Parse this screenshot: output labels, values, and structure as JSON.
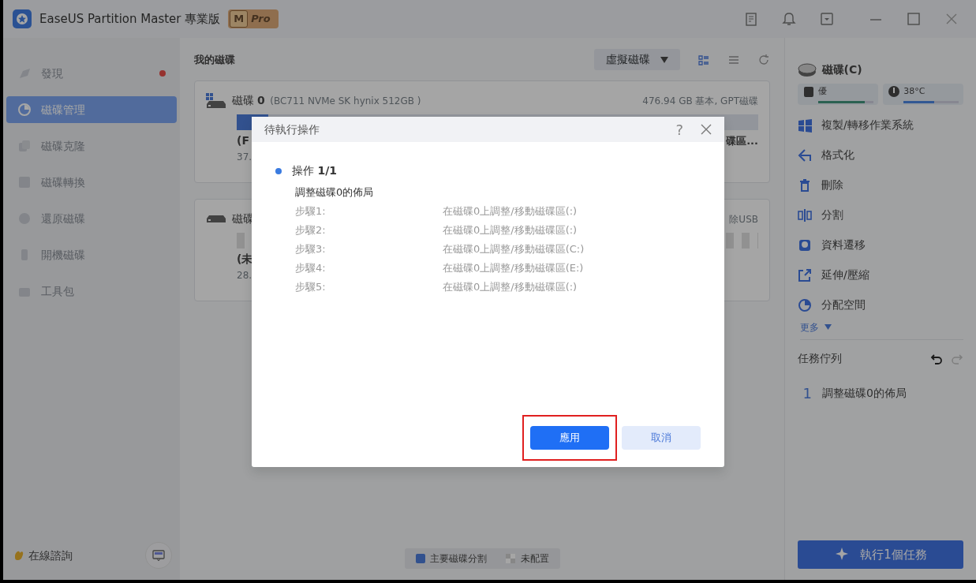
{
  "window": {
    "title": "EaseUS Partition Master 專業版",
    "badge_letter": "M",
    "badge": "Pro"
  },
  "sidebar": {
    "items": [
      {
        "label": "發現",
        "selected": false,
        "notification": true
      },
      {
        "label": "磁碟管理",
        "selected": true,
        "notification": false
      },
      {
        "label": "磁碟克隆",
        "selected": false,
        "notification": false
      },
      {
        "label": "磁碟轉換",
        "selected": false,
        "notification": false
      },
      {
        "label": "還原磁碟",
        "selected": false,
        "notification": false
      },
      {
        "label": "開機磁碟",
        "selected": false,
        "notification": false
      },
      {
        "label": "工具包",
        "selected": false,
        "notification": false
      }
    ],
    "chat": "在線諮詢"
  },
  "main": {
    "title": "我的磁碟",
    "view_dropdown": "虛擬磁碟",
    "disks": [
      {
        "name": "磁碟 **0**",
        "model": "(BC711 NVMe SK hynix 512GB )",
        "info": "476.94 GB 基本, GPT磁碟",
        "partition_label": "(F",
        "partition_size": "37.",
        "partition_right": "碟區...",
        "kind": "system"
      },
      {
        "name": "磁碟",
        "info": "除USB",
        "partition_label": "(未",
        "partition_size": "28.",
        "kind": "usb"
      }
    ],
    "legend": [
      {
        "label": "主要磁碟分割",
        "kind": "primary"
      },
      {
        "label": "未配置",
        "kind": "unallocated"
      }
    ]
  },
  "right_panel": {
    "drive": "磁碟(C)",
    "health": {
      "label": "優",
      "level": 0.85
    },
    "temperature": {
      "label": "38°C",
      "level": 0.55
    },
    "actions": [
      "複製/轉移作業系統",
      "格式化",
      "刪除",
      "分割",
      "資料遷移",
      "延伸/壓縮",
      "分配空間"
    ],
    "more": "更多",
    "queue_title": "任務佇列",
    "queue": [
      {
        "number": "1",
        "label": "調整磁碟0的佈局"
      }
    ],
    "execute": "執行1個任務"
  },
  "dialog": {
    "title": "待執行操作",
    "help": "?",
    "operation": "操作 **1/1**",
    "description": "調整磁碟0的佈局",
    "steps": [
      {
        "label": "步驟1:",
        "detail": "在磁碟0上調整/移動磁碟區(:)"
      },
      {
        "label": "步驟2:",
        "detail": "在磁碟0上調整/移動磁碟區(:)"
      },
      {
        "label": "步驟3:",
        "detail": "在磁碟0上調整/移動磁碟區(C:)"
      },
      {
        "label": "步驟4:",
        "detail": "在磁碟0上調整/移動磁碟區(E:)"
      },
      {
        "label": "步驟5:",
        "detail": "在磁碟0上調整/移動磁碟區(:)"
      }
    ],
    "apply": "應用",
    "cancel": "取消",
    "apply_highlighted": true
  }
}
